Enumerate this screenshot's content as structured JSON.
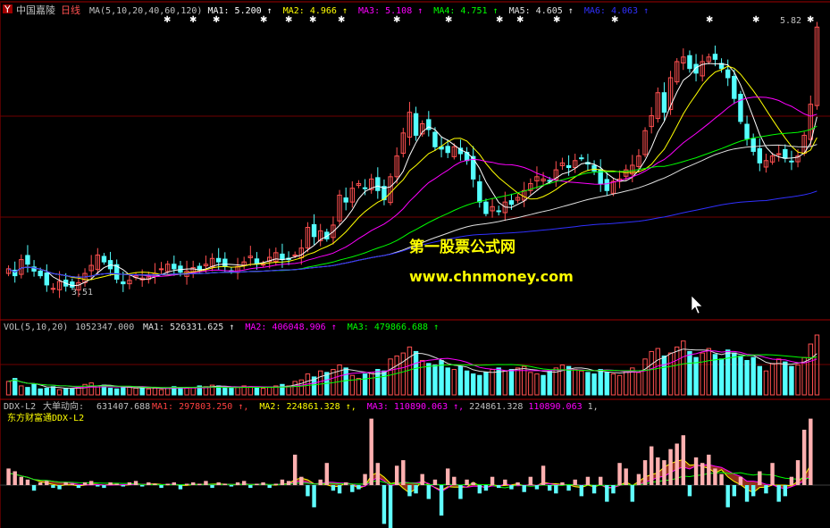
{
  "stock": {
    "name": "中国嘉陵",
    "period": "日线"
  },
  "colors": {
    "bg": "#000000",
    "frame": "#a00000",
    "up": "#ff5050",
    "down": "#54ffff",
    "ma1": "#ffffff",
    "ma2": "#ffff00",
    "ma3": "#ff00ff",
    "ma4": "#00ff00",
    "ma5": "#e0e0e0",
    "ma6": "#3030ff",
    "text": "#c0c0c0",
    "watermark": "#ffff00"
  },
  "main_legend": {
    "label": "MA(5,10,20,40,60,120)",
    "items": [
      {
        "key": "MA1:",
        "value": "5.200",
        "color": "#ffffff"
      },
      {
        "key": "MA2:",
        "value": "4.966",
        "color": "#ffff00"
      },
      {
        "key": "MA3:",
        "value": "5.108",
        "color": "#ff00ff"
      },
      {
        "key": "MA4:",
        "value": "4.751",
        "color": "#00ff00"
      },
      {
        "key": "MA5:",
        "value": "4.605",
        "color": "#e0e0e0"
      },
      {
        "key": "MA6:",
        "value": "4.063",
        "color": "#3030ff"
      }
    ]
  },
  "vol_legend": {
    "label": "VOL(5,10,20)",
    "value": "1052347.000",
    "items": [
      {
        "key": "MA1:",
        "value": "526331.625",
        "color": "#e0e0e0"
      },
      {
        "key": "MA2:",
        "value": "406048.906",
        "color": "#ff00ff"
      },
      {
        "key": "MA3:",
        "value": "479866.688",
        "color": "#00ff00"
      }
    ]
  },
  "ddx_legend": {
    "label": "DDX-L2",
    "name": "大单动向:",
    "value": "631407.688",
    "items": [
      {
        "key": "MA1:",
        "value": "297803.250",
        "color": "#ff4040"
      },
      {
        "key": "MA2:",
        "value": "224861.328",
        "color": "#ffff00"
      },
      {
        "key": "MA3:",
        "value": "110890.063",
        "color": "#ff00ff"
      }
    ],
    "tail": [
      {
        "value": "224861.328",
        "color": "#c0c0c0"
      },
      {
        "value": "110890.063",
        "color": "#ff00ff"
      },
      {
        "value": "1,",
        "color": "#c0c0c0"
      }
    ],
    "subtitle": "东方财富通DDX-L2"
  },
  "annotations": {
    "high_label": "5.82",
    "low_label": "3.51",
    "watermark_cn": "第一股票公式网",
    "watermark_url": "www.chnmoney.com"
  },
  "chart_data": {
    "type": "candlestick",
    "price_panel": {
      "ylim": [
        3.3,
        5.9
      ]
    },
    "closes": [
      3.72,
      3.66,
      3.8,
      3.76,
      3.7,
      3.66,
      3.58,
      3.55,
      3.61,
      3.57,
      3.56,
      3.6,
      3.68,
      3.75,
      3.84,
      3.78,
      3.72,
      3.63,
      3.59,
      3.62,
      3.66,
      3.64,
      3.65,
      3.68,
      3.72,
      3.76,
      3.72,
      3.69,
      3.7,
      3.73,
      3.71,
      3.76,
      3.81,
      3.78,
      3.74,
      3.7,
      3.74,
      3.78,
      3.83,
      3.76,
      3.76,
      3.82,
      3.86,
      3.8,
      3.8,
      3.84,
      3.9,
      4.08,
      4.0,
      4.05,
      3.98,
      4.1,
      4.36,
      4.3,
      4.42,
      4.46,
      4.42,
      4.5,
      4.4,
      4.32,
      4.52,
      4.7,
      4.9,
      5.08,
      4.88,
      4.98,
      4.93,
      4.78,
      4.76,
      4.73,
      4.78,
      4.72,
      4.66,
      4.5,
      4.3,
      4.2,
      4.26,
      4.22,
      4.3,
      4.28,
      4.34,
      4.4,
      4.46,
      4.52,
      4.5,
      4.48,
      4.58,
      4.64,
      4.6,
      4.66,
      4.68,
      4.63,
      4.57,
      4.46,
      4.4,
      4.48,
      4.5,
      4.58,
      4.62,
      4.7,
      4.92,
      5.05,
      5.25,
      5.08,
      5.38,
      5.52,
      5.56,
      5.46,
      5.42,
      5.52,
      5.56,
      5.54,
      5.46,
      5.38,
      5.2,
      5.0,
      4.85,
      4.74,
      4.64,
      4.66,
      4.7,
      4.72,
      4.68,
      4.65,
      4.7,
      4.88,
      5.15,
      5.82
    ],
    "ma_periods": [
      5,
      10,
      20,
      40,
      60,
      120
    ],
    "volume": [
      18,
      22,
      12,
      10,
      14,
      8,
      9,
      11,
      7,
      9,
      8,
      10,
      14,
      16,
      12,
      13,
      9,
      8,
      10,
      11,
      9,
      10,
      8,
      9,
      7,
      9,
      11,
      10,
      9,
      10,
      12,
      11,
      13,
      12,
      10,
      9,
      10,
      12,
      11,
      10,
      9,
      10,
      12,
      14,
      12,
      18,
      20,
      28,
      24,
      32,
      30,
      34,
      40,
      36,
      26,
      22,
      28,
      30,
      34,
      32,
      48,
      52,
      56,
      64,
      58,
      46,
      42,
      40,
      46,
      36,
      34,
      38,
      32,
      28,
      26,
      30,
      34,
      36,
      32,
      34,
      36,
      38,
      30,
      28,
      26,
      32,
      36,
      40,
      38,
      34,
      32,
      30,
      28,
      34,
      30,
      28,
      26,
      32,
      36,
      30,
      48,
      58,
      62,
      52,
      56,
      64,
      72,
      58,
      50,
      56,
      62,
      54,
      48,
      60,
      56,
      52,
      46,
      50,
      38,
      32,
      42,
      48,
      44,
      38,
      40,
      50,
      68,
      80
    ],
    "ddx": [
      12,
      10,
      6,
      4,
      -4,
      2,
      3,
      -2,
      -3,
      2,
      1,
      -2,
      2,
      3,
      -1,
      -2,
      2,
      1,
      -1,
      2,
      3,
      -1,
      2,
      1,
      -2,
      1,
      2,
      -3,
      1,
      2,
      1,
      3,
      -2,
      2,
      1,
      -1,
      2,
      3,
      -2,
      1,
      2,
      -2,
      1,
      4,
      3,
      22,
      6,
      -8,
      -16,
      4,
      16,
      -4,
      -6,
      2,
      -5,
      -3,
      8,
      48,
      16,
      -28,
      -36,
      14,
      18,
      -8,
      -6,
      8,
      -10,
      4,
      -22,
      12,
      6,
      -10,
      4,
      2,
      -6,
      -4,
      6,
      -2,
      4,
      -3,
      2,
      -5,
      6,
      -3,
      14,
      -4,
      -6,
      2,
      -4,
      4,
      -8,
      6,
      -6,
      6,
      -12,
      -6,
      16,
      12,
      -12,
      8,
      18,
      28,
      20,
      18,
      26,
      30,
      36,
      -8,
      20,
      16,
      22,
      12,
      8,
      -16,
      -8,
      6,
      -12,
      -8,
      10,
      -6,
      16,
      -12,
      -8,
      6,
      18,
      40,
      48
    ]
  }
}
